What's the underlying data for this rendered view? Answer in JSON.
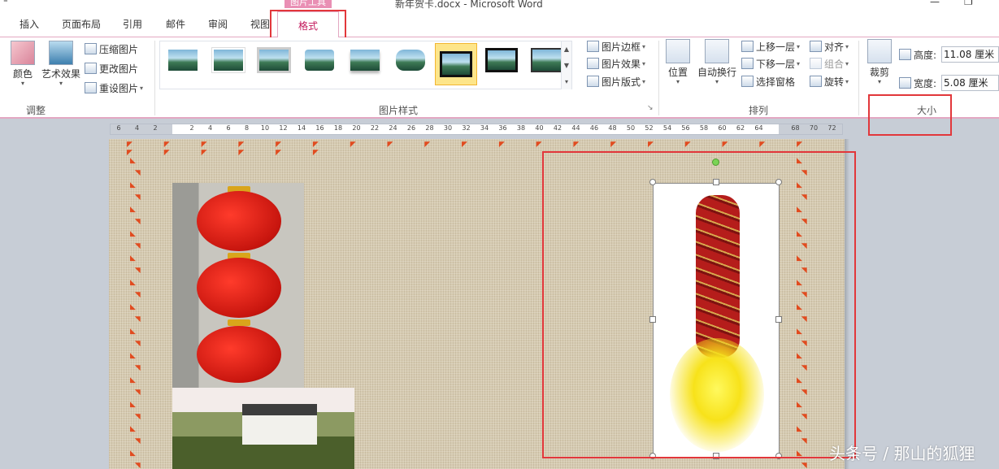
{
  "window": {
    "quick_access": "⁼",
    "context_tab_title": "图片工具",
    "doc_title": "新年贺卡.docx  -  Microsoft Word",
    "minimize": "—",
    "restore": "❐"
  },
  "tabs": [
    {
      "label": "插入"
    },
    {
      "label": "页面布局"
    },
    {
      "label": "引用"
    },
    {
      "label": "邮件"
    },
    {
      "label": "审阅"
    },
    {
      "label": "视图"
    },
    {
      "label": "格式",
      "active": true
    }
  ],
  "ribbon": {
    "adjust": {
      "group_label": "调整",
      "color_label": "颜色",
      "artistic_label": "艺术效果",
      "compress_label": "压缩图片",
      "change_label": "更改图片",
      "reset_label": "重设图片"
    },
    "styles": {
      "group_label": "图片样式",
      "thumbnail_count": 9,
      "selected_index": 6,
      "border_label": "图片边框",
      "effects_label": "图片效果",
      "layout_label": "图片版式"
    },
    "arrange": {
      "group_label": "排列",
      "position_label": "位置",
      "wrap_label": "自动换行",
      "bring_forward_label": "上移一层",
      "send_backward_label": "下移一层",
      "selection_pane_label": "选择窗格",
      "align_label": "对齐",
      "group_btn_label": "组合",
      "rotate_label": "旋转"
    },
    "size": {
      "group_label": "大小",
      "crop_label": "裁剪",
      "height_label": "高度:",
      "height_value": "11.08 厘米",
      "width_label": "宽度:",
      "width_value": "5.08 厘米"
    }
  },
  "ruler": {
    "ticks": [
      "6",
      "4",
      "2",
      "2",
      "4",
      "6",
      "8",
      "10",
      "12",
      "14",
      "16",
      "18",
      "20",
      "22",
      "24",
      "26",
      "28",
      "30",
      "32",
      "34",
      "36",
      "38",
      "40",
      "42",
      "44",
      "46",
      "48",
      "50",
      "52",
      "54",
      "56",
      "58",
      "60",
      "62",
      "64",
      "68",
      "70",
      "72"
    ]
  },
  "watermark": "头条号 / 那山的狐狸",
  "colors": {
    "accent_pink": "#e98fb4",
    "highlight_red": "#e2373b",
    "page_background": "#d6cbb1"
  }
}
